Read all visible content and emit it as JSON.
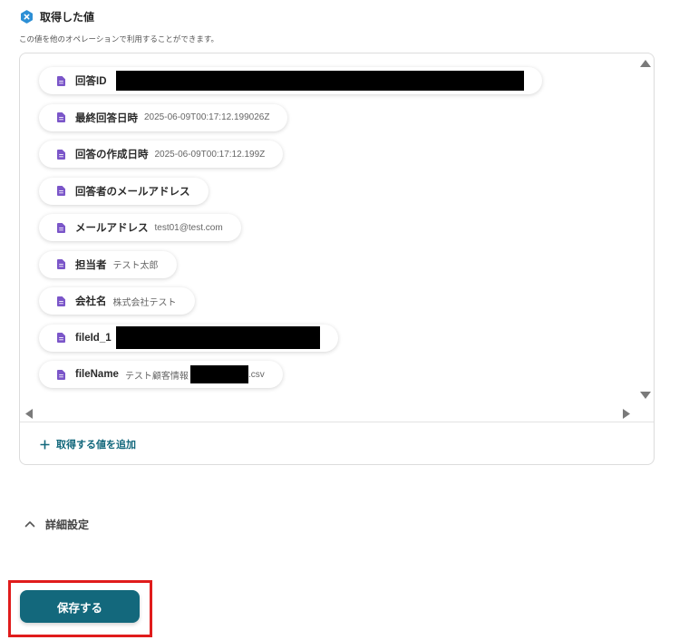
{
  "section": {
    "icon": "x-badge-icon",
    "title": "取得した値",
    "description": "この値を他のオペレーションで利用することができます。"
  },
  "fields": [
    {
      "icon": "document-icon",
      "label": "回答ID",
      "redacted": true
    },
    {
      "icon": "document-icon",
      "label": "最終回答日時",
      "value": "2025-06-09T00:17:12.199026Z"
    },
    {
      "icon": "document-icon",
      "label": "回答の作成日時",
      "value": "2025-06-09T00:17:12.199Z"
    },
    {
      "icon": "document-icon",
      "label": "回答者のメールアドレス"
    },
    {
      "icon": "document-icon",
      "label": "メールアドレス",
      "value": "test01@test.com"
    },
    {
      "icon": "document-icon",
      "label": "担当者",
      "value": "テスト太郎"
    },
    {
      "icon": "document-icon",
      "label": "会社名",
      "value": "株式会社テスト"
    },
    {
      "icon": "document-icon",
      "label": "fileId_1",
      "redacted": true
    },
    {
      "icon": "document-icon",
      "label": "fileName",
      "value_prefix": "テスト顧客情報",
      "value_suffix": ".csv",
      "redacted": true
    }
  ],
  "scrollbar": {
    "icons": [
      "triangle-up-icon",
      "triangle-down-icon",
      "triangle-left-icon",
      "triangle-right-icon"
    ]
  },
  "add_value": {
    "icon": "plus-icon",
    "label": "取得する値を追加"
  },
  "advanced_settings": {
    "icon": "chevron-up-icon",
    "label": "詳細設定"
  },
  "save_button": {
    "label": "保存する"
  },
  "colors": {
    "accent": "#13687c",
    "doc": "#7b56c9",
    "badge": "#2d8fd5",
    "highlight": "#e01c1c"
  }
}
